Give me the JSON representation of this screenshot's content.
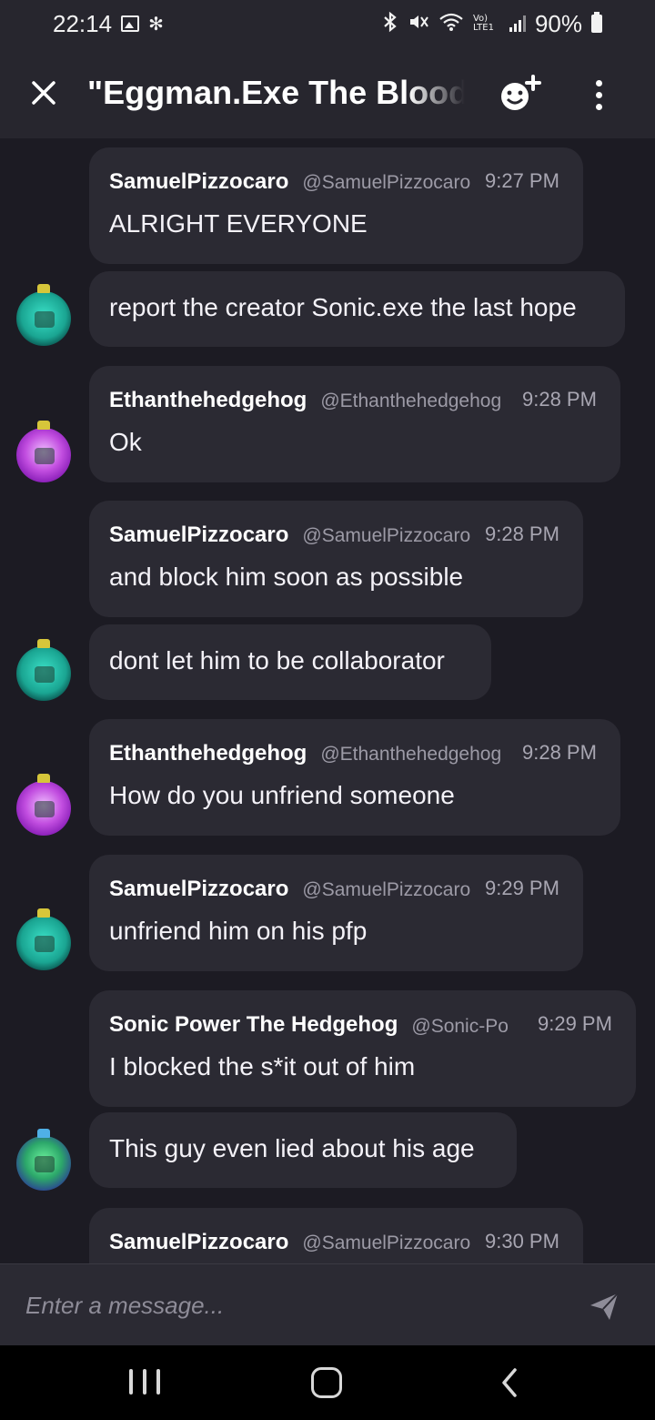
{
  "status_bar": {
    "time": "22:14",
    "left_icons": [
      "gallery-icon",
      "fan-icon"
    ],
    "right_icons": [
      "bluetooth-icon",
      "mute-icon",
      "wifi-icon",
      "volte-icon",
      "signal-icon"
    ],
    "volte_label": "Vo) LTE1",
    "battery_percent": "90%",
    "battery_level": 0.9
  },
  "header": {
    "title": "\"Eggman.Exe  The Blood",
    "close_icon": "close-icon",
    "add_member_icon": "add-member-emoji-icon",
    "more_icon": "more-vertical-icon"
  },
  "messages": [
    {
      "name": "SamuelPizzocaro",
      "handle": "@SamuelPizzocaro",
      "time": "9:27 PM",
      "text": "ALRIGHT EVERYONE"
    },
    {
      "text": "report the creator Sonic.exe the last hope",
      "avatar": "teal"
    },
    {
      "name": "Ethanthehedgehog",
      "handle": "@Ethanthehedgehog",
      "time": "9:28 PM",
      "text": "Ok",
      "avatar": "purple"
    },
    {
      "name": "SamuelPizzocaro",
      "handle": "@SamuelPizzocaro",
      "time": "9:28 PM",
      "text": "and block him soon as possible"
    },
    {
      "text": "dont let him to be collaborator",
      "avatar": "teal"
    },
    {
      "name": "Ethanthehedgehog",
      "handle": "@Ethanthehedgehog",
      "time": "9:28 PM",
      "text": "How do you unfriend someone",
      "avatar": "purple"
    },
    {
      "name": "SamuelPizzocaro",
      "handle": "@SamuelPizzocaro",
      "time": "9:29 PM",
      "text": "unfriend him on his pfp",
      "avatar": "teal"
    },
    {
      "name": "Sonic Power The Hedgehog",
      "handle": "@Sonic-Pow",
      "time": "9:29 PM",
      "text": "I blocked the s*it out of him"
    },
    {
      "text": "This guy even lied about his age",
      "avatar": "green"
    },
    {
      "name": "SamuelPizzocaro",
      "handle": "@SamuelPizzocaro",
      "time": "9:30 PM",
      "text": ""
    }
  ],
  "composer": {
    "placeholder": "Enter a message...",
    "send_icon": "send-icon"
  },
  "navigation": {
    "recent_icon": "recent-apps-icon",
    "home_icon": "home-icon",
    "back_icon": "back-icon"
  }
}
